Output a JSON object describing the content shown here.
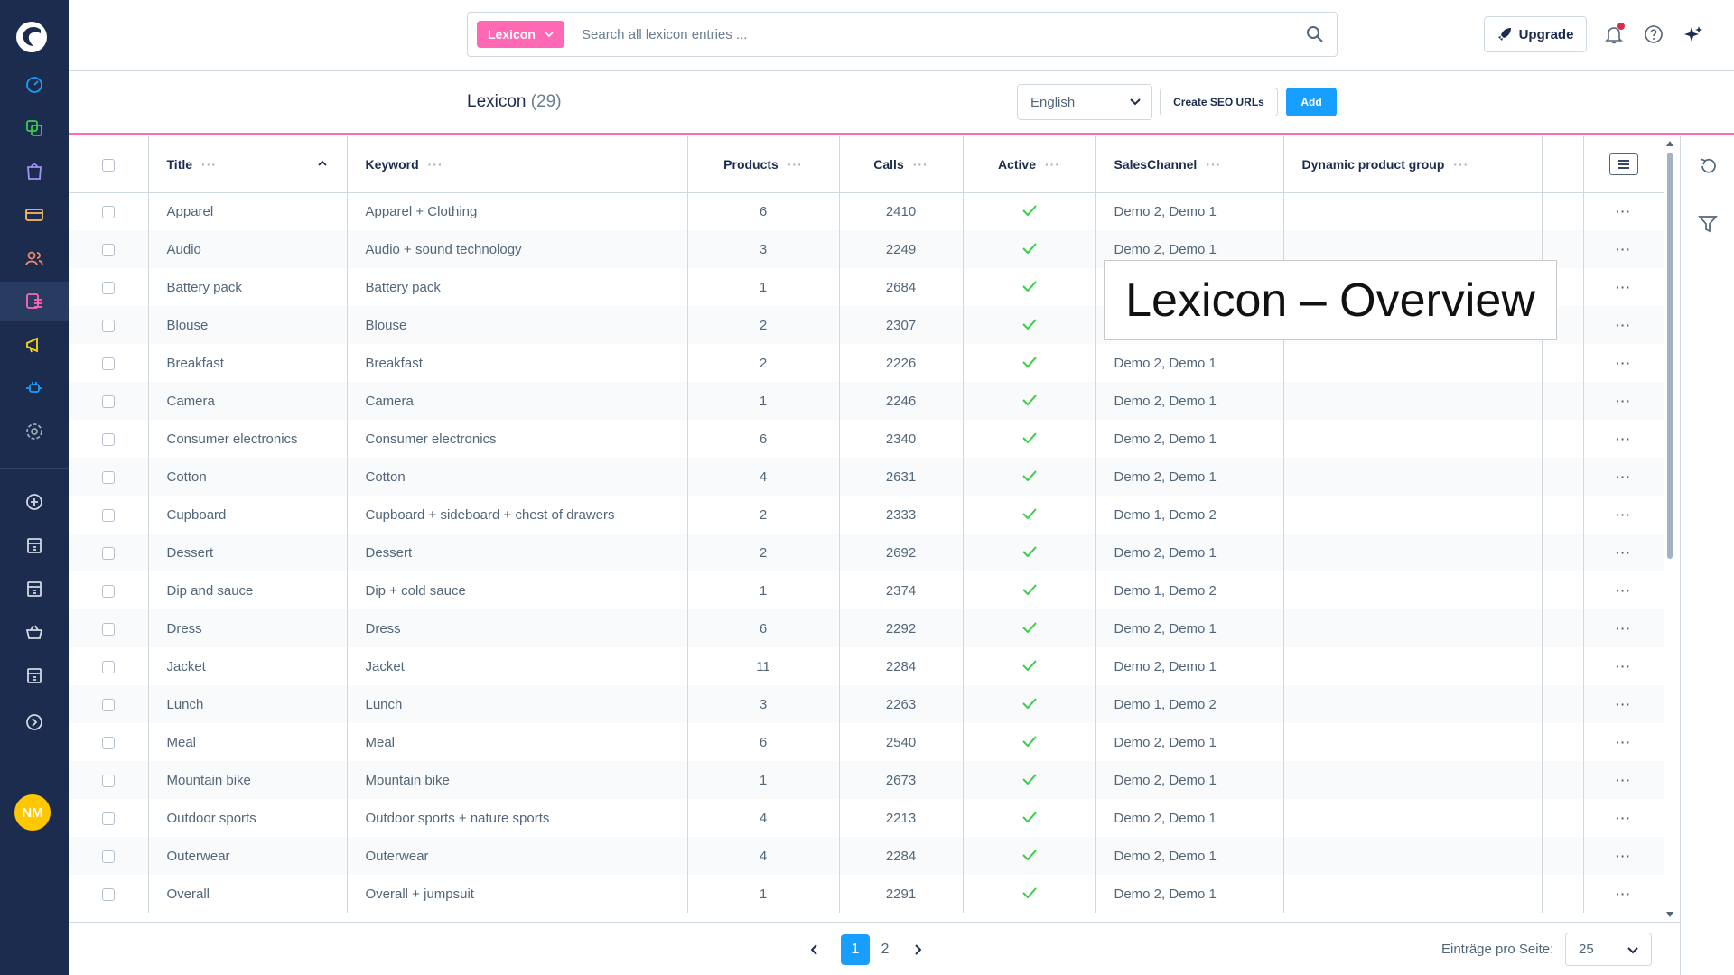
{
  "sidebar": {
    "avatar_initials": "NM",
    "items": [
      {
        "icon": "dashboard-icon"
      },
      {
        "icon": "catalogue-icon"
      },
      {
        "icon": "orders-icon"
      },
      {
        "icon": "payment-icon"
      },
      {
        "icon": "customers-icon"
      },
      {
        "icon": "content-icon",
        "active": true
      },
      {
        "icon": "marketing-icon"
      },
      {
        "icon": "extensions-icon"
      },
      {
        "icon": "settings-icon"
      },
      {
        "icon": "add-sales-channel-icon"
      },
      {
        "icon": "storefront-icon"
      },
      {
        "icon": "storefront-icon"
      },
      {
        "icon": "basket-icon"
      },
      {
        "icon": "storefront-icon"
      },
      {
        "icon": "collapse-icon"
      }
    ]
  },
  "header": {
    "search_type": "Lexicon",
    "search_placeholder": "Search all lexicon entries ...",
    "upgrade_label": "Upgrade"
  },
  "smartbar": {
    "title": "Lexicon",
    "count": "(29)",
    "language": "English",
    "seo_button": "Create SEO URLs",
    "add_button": "Add"
  },
  "grid": {
    "columns": [
      "Title",
      "Keyword",
      "Products",
      "Calls",
      "Active",
      "SalesChannel",
      "Dynamic product group"
    ],
    "rows": [
      {
        "title": "Apparel",
        "keyword": "Apparel + Clothing",
        "products": "6",
        "calls": "2410",
        "channels": "Demo 2, Demo 1"
      },
      {
        "title": "Audio",
        "keyword": "Audio + sound technology",
        "products": "3",
        "calls": "2249",
        "channels": "Demo 2, Demo 1"
      },
      {
        "title": "Battery pack",
        "keyword": "Battery pack",
        "products": "1",
        "calls": "2684",
        "channels": ""
      },
      {
        "title": "Blouse",
        "keyword": "Blouse",
        "products": "2",
        "calls": "2307",
        "channels": ""
      },
      {
        "title": "Breakfast",
        "keyword": "Breakfast",
        "products": "2",
        "calls": "2226",
        "channels": "Demo 2, Demo 1"
      },
      {
        "title": "Camera",
        "keyword": "Camera",
        "products": "1",
        "calls": "2246",
        "channels": "Demo 2, Demo 1"
      },
      {
        "title": "Consumer electronics",
        "keyword": "Consumer electronics",
        "products": "6",
        "calls": "2340",
        "channels": "Demo 2, Demo 1"
      },
      {
        "title": "Cotton",
        "keyword": "Cotton",
        "products": "4",
        "calls": "2631",
        "channels": "Demo 2, Demo 1"
      },
      {
        "title": "Cupboard",
        "keyword": "Cupboard + sideboard + chest of drawers",
        "products": "2",
        "calls": "2333",
        "channels": "Demo 1, Demo 2"
      },
      {
        "title": "Dessert",
        "keyword": "Dessert",
        "products": "2",
        "calls": "2692",
        "channels": "Demo 2, Demo 1"
      },
      {
        "title": "Dip and sauce",
        "keyword": "Dip + cold sauce",
        "products": "1",
        "calls": "2374",
        "channels": "Demo 1, Demo 2"
      },
      {
        "title": "Dress",
        "keyword": "Dress",
        "products": "6",
        "calls": "2292",
        "channels": "Demo 2, Demo 1"
      },
      {
        "title": "Jacket",
        "keyword": "Jacket",
        "products": "11",
        "calls": "2284",
        "channels": "Demo 2, Demo 1"
      },
      {
        "title": "Lunch",
        "keyword": "Lunch",
        "products": "3",
        "calls": "2263",
        "channels": "Demo 1, Demo 2"
      },
      {
        "title": "Meal",
        "keyword": "Meal",
        "products": "6",
        "calls": "2540",
        "channels": "Demo 2, Demo 1"
      },
      {
        "title": "Mountain bike",
        "keyword": "Mountain bike",
        "products": "1",
        "calls": "2673",
        "channels": "Demo 2, Demo 1"
      },
      {
        "title": "Outdoor sports",
        "keyword": "Outdoor sports + nature sports",
        "products": "4",
        "calls": "2213",
        "channels": "Demo 2, Demo 1"
      },
      {
        "title": "Outerwear",
        "keyword": "Outerwear",
        "products": "4",
        "calls": "2284",
        "channels": "Demo 2, Demo 1"
      },
      {
        "title": "Overall",
        "keyword": "Overall + jumpsuit",
        "products": "1",
        "calls": "2291",
        "channels": "Demo 2, Demo 1"
      }
    ]
  },
  "pagination": {
    "pages": [
      "1",
      "2"
    ],
    "current": "1",
    "per_page_label": "Einträge pro Seite:",
    "per_page_value": "25"
  },
  "caption": "Lexicon – Overview",
  "colors": {
    "sidebar": "#1b2c4e",
    "accent_pink": "#ff68b4",
    "primary_blue": "#189eff",
    "check_green": "#37d046"
  }
}
